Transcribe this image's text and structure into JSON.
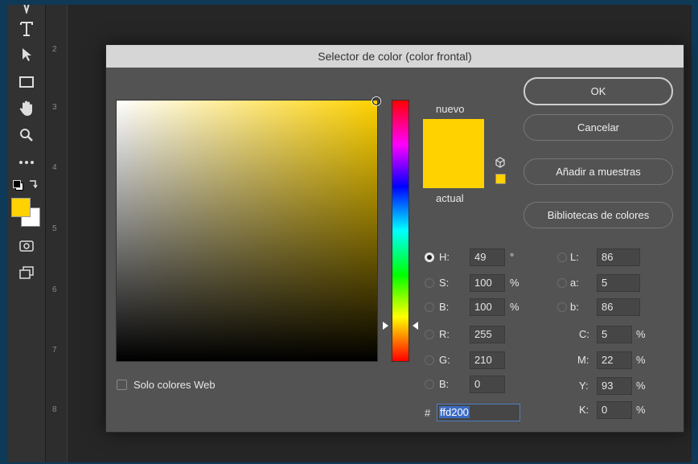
{
  "toolbar": {
    "tools": [
      "type-tool-icon",
      "path-select-icon",
      "frame-icon",
      "hand-icon",
      "zoom-icon",
      "more-icon"
    ],
    "foreground": "#ffd200",
    "background": "#ffffff"
  },
  "ruler": {
    "ticks": [
      "2",
      "3",
      "4",
      "5",
      "6",
      "7",
      "8"
    ]
  },
  "dialog": {
    "title": "Selector de color (color frontal)",
    "buttons": {
      "ok": "OK",
      "cancel": "Cancelar",
      "add_swatch": "Añadir a muestras",
      "libraries": "Bibliotecas de colores"
    },
    "swatch": {
      "new_label": "nuevo",
      "current_label": "actual",
      "new_color": "#ffd200",
      "current_color": "#ffd200"
    },
    "web_only": {
      "label": "Solo colores Web",
      "checked": false
    },
    "hsb": {
      "h": {
        "label": "H:",
        "value": "49",
        "unit": "°"
      },
      "s": {
        "label": "S:",
        "value": "100",
        "unit": "%"
      },
      "b": {
        "label": "B:",
        "value": "100",
        "unit": "%"
      }
    },
    "rgb": {
      "r": {
        "label": "R:",
        "value": "255"
      },
      "g": {
        "label": "G:",
        "value": "210"
      },
      "b": {
        "label": "B:",
        "value": "0"
      }
    },
    "lab": {
      "l": {
        "label": "L:",
        "value": "86"
      },
      "a": {
        "label": "a:",
        "value": "5"
      },
      "b": {
        "label": "b:",
        "value": "86"
      }
    },
    "cmyk": {
      "c": {
        "label": "C:",
        "value": "5",
        "unit": "%"
      },
      "m": {
        "label": "M:",
        "value": "22",
        "unit": "%"
      },
      "y": {
        "label": "Y:",
        "value": "93",
        "unit": "%"
      },
      "k": {
        "label": "K:",
        "value": "0",
        "unit": "%"
      }
    },
    "hex": {
      "label": "#",
      "value": "ffd200"
    }
  }
}
